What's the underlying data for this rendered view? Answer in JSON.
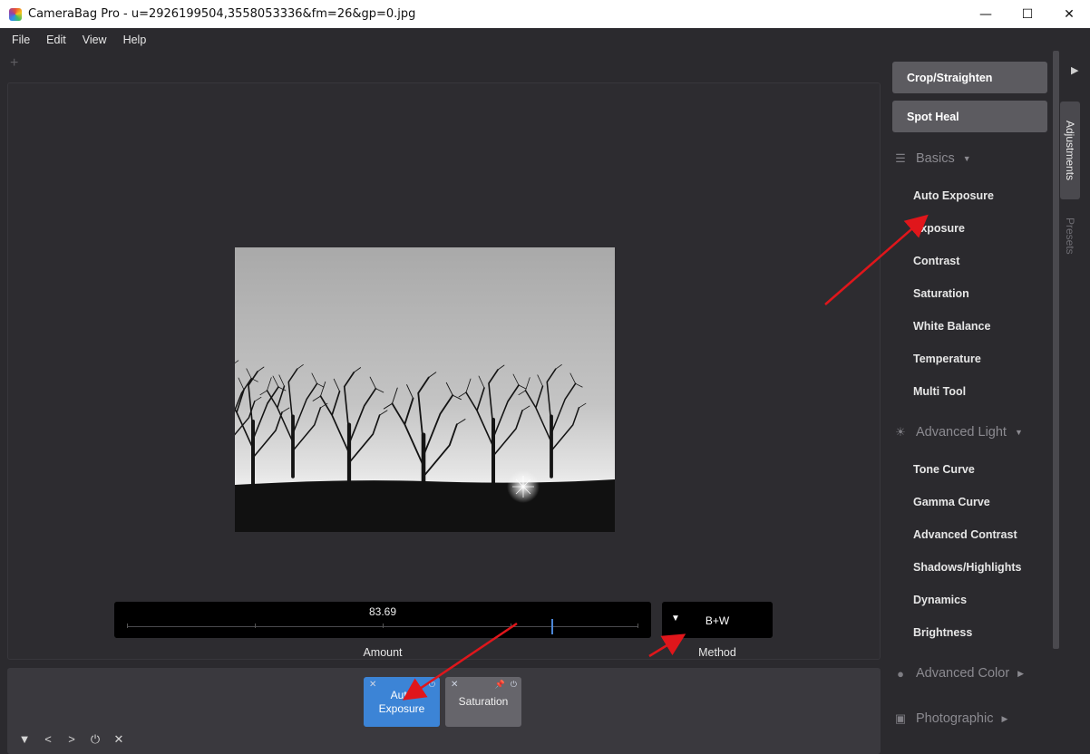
{
  "window": {
    "title": "CameraBag Pro - u=2926199504,3558053336&fm=26&gp=0.jpg",
    "minimize": "—",
    "maximize": "☐",
    "close": "✕"
  },
  "menu": [
    "File",
    "Edit",
    "View",
    "Help"
  ],
  "workspace": {
    "add_symbol": "+"
  },
  "amount": {
    "value": "83.69",
    "fraction": 0.83,
    "label": "Amount"
  },
  "method": {
    "value": "B+W",
    "label": "Method"
  },
  "tray": {
    "cards": [
      {
        "label_line1": "Auto",
        "label_line2": "Exposure",
        "state": "active"
      },
      {
        "label_line1": "Saturation",
        "label_line2": "",
        "state": "inactive"
      }
    ],
    "controls": [
      "▼",
      "<",
      ">",
      "⏻",
      "✕"
    ]
  },
  "right_panel": {
    "tool_buttons": [
      "Crop/Straighten",
      "Spot Heal"
    ],
    "basics": {
      "title": "Basics",
      "items": [
        "Auto Exposure",
        "Exposure",
        "Contrast",
        "Saturation",
        "White Balance",
        "Temperature",
        "Multi Tool"
      ]
    },
    "advanced_light": {
      "title": "Advanced Light",
      "items": [
        "Tone Curve",
        "Gamma Curve",
        "Advanced Contrast",
        "Shadows/Highlights",
        "Dynamics",
        "Brightness"
      ]
    },
    "advanced_color": {
      "title": "Advanced Color"
    },
    "photographic": {
      "title": "Photographic"
    }
  },
  "side_tabs": {
    "adjustments": "Adjustments",
    "presets": "Presets",
    "collapse": "▶"
  },
  "colors": {
    "accent": "#3c84d6",
    "annotation": "#e0161b"
  }
}
